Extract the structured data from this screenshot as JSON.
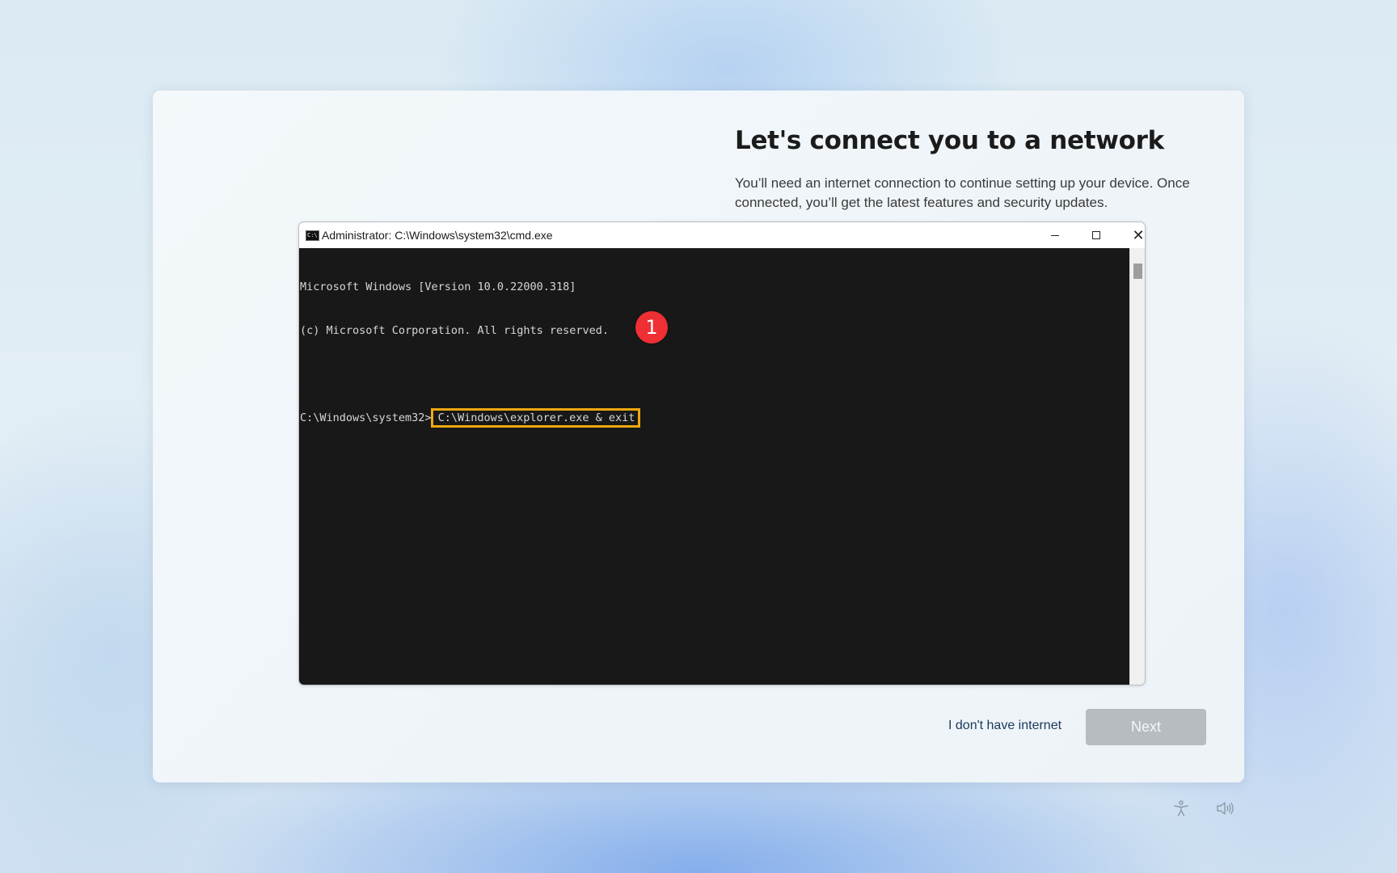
{
  "page": {
    "title": "Let's connect you to a network",
    "description": "You’ll need an internet connection to continue setting up your device. Once connected, you’ll get the latest features and security updates."
  },
  "cmd_window": {
    "title": "Administrator: C:\\Windows\\system32\\cmd.exe",
    "app_icon_text": "C:\\",
    "lines": [
      "Microsoft Windows [Version 10.0.22000.318]",
      "(c) Microsoft Corporation. All rights reserved."
    ],
    "prompt": "C:\\Windows\\system32>",
    "command": "C:\\Windows\\explorer.exe & exit"
  },
  "annotation": {
    "step_number": "1",
    "highlight_color": "#f0a810",
    "badge_color": "#ee2f34"
  },
  "actions": {
    "no_internet_label": "I don't have internet",
    "next_label": "Next"
  },
  "system_tray": {
    "icons": [
      "accessibility-icon",
      "volume-icon"
    ]
  }
}
